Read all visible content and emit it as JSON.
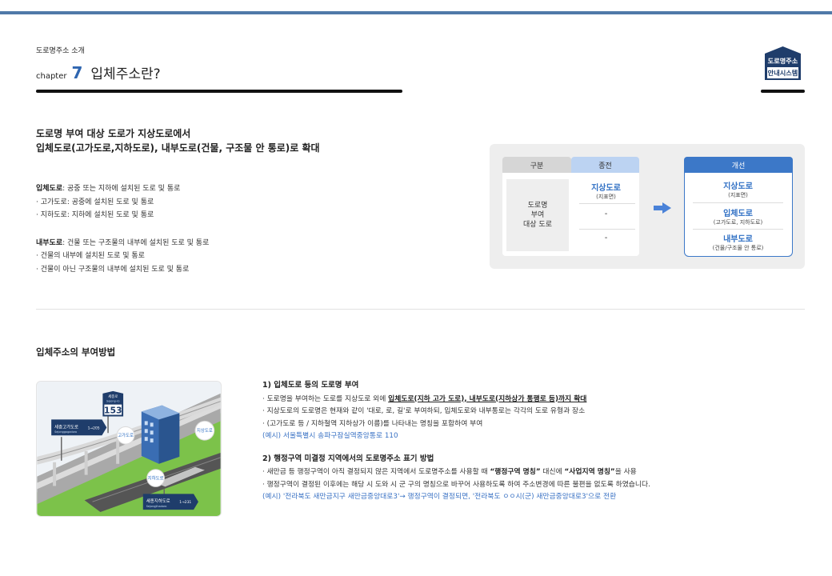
{
  "header": {
    "breadcrumb": "도로명주소 소개",
    "chapter_word": "chapter",
    "chapter_number": "7",
    "title": "입체주소란?",
    "logo_line1": "도로명주소",
    "logo_line2": "안내시스템"
  },
  "intro": {
    "line1": "도로명 부여 대상 도로가 지상도로에서",
    "line2": "입체도로(고가도로,지하도로), 내부도로(건물, 구조물 안 통로)로 확대"
  },
  "definitions": {
    "ipche_term": "입체도로",
    "ipche_desc": ": 공중 또는 지하에 설치된 도로 및 통로",
    "ipche_items": [
      "· 고가도로: 공중에 설치된 도로 및 통로",
      "· 지하도로: 지하에 설치된 도로 및 통로"
    ],
    "naebu_term": "내부도로",
    "naebu_desc": ": 건물 또는 구조물의 내부에 설치된 도로 및 통로",
    "naebu_items": [
      "· 건물의 내부에 설치된 도로 및 통로",
      "· 건물이 아닌 구조물의 내부에 설치된 도로 및 통로"
    ]
  },
  "comparison": {
    "col_gubun": "구분",
    "col_prev": "종전",
    "col_new": "개선",
    "gubun_line1": "도로명",
    "gubun_line2": "부여",
    "gubun_line3": "대상 도로",
    "prev_main": "지상도로",
    "prev_sub": "(지표면)",
    "prev_dash1": "-",
    "prev_dash2": "-",
    "new_items": [
      {
        "main": "지상도로",
        "sub": "(지표면)"
      },
      {
        "main": "입체도로",
        "sub": "(고가도로, 지하도로)"
      },
      {
        "main": "내부도로",
        "sub": "(건물/구조물 안 통로)"
      }
    ]
  },
  "section": {
    "title": "입체주소의 부여방법"
  },
  "illustration": {
    "sign_top_name": "세종로",
    "sign_top_roman": "Sejong-ro",
    "sign_top_number": "153",
    "sign_elevated_name": "세종고가도로",
    "sign_elevated_number": "1→205",
    "sign_elevated_roman": "Sejonggogadoro",
    "sign_underground_name": "세종지하도로",
    "sign_underground_number": "1→231",
    "sign_underground_roman": "Sejongjihadoro",
    "bubble_goga": "고가도로",
    "bubble_jisang": "지상도로",
    "bubble_jiha": "지하도로"
  },
  "methods": {
    "m1_title": "1) 입체도로 등의 도로명 부여",
    "m1_l1_pre": "· 도로명을 부여하는 도로를 지상도로 외에 ",
    "m1_l1_em": "입체도로(지하  고가 도로), 내부도로(지하상가 통행로 등)까지 확대",
    "m1_l2": "· 지상도로의 도로명은 현재와 같이 '대로, 로, 길'로 부여하되, 입체도로와 내부통로는 각각의 도로 유형과 장소",
    "m1_l3": "· (고가도로 등 / 지하철역  지하상가 이름)를 나타내는 명칭을 포함하여 부여",
    "m1_example": "(예시) 서울특별시 송파구잠실역중앙통로 110",
    "m2_title": "2) 행정구역 미결정 지역에서의 도로명주소 표기 방법",
    "m2_l1_pre": "· 새만금 등 행정구역이 아직 결정되지 않은 지역에서 도로명주소를 사용할 때 ",
    "m2_l1_b1": "“행정구역 명칭”",
    "m2_l1_mid": " 대신에 ",
    "m2_l1_b2": "“사업지역 명칭”",
    "m2_l1_post": "을 사용",
    "m2_l2": "· 행정구역이 결정된 이후에는 해당 시  도와 시  군  구의 명칭으로 바꾸어 사용하도록 하여 주소변경에 따른 불편을 없도록 하였습니다.",
    "m2_example": "(예시) '전라북도 새만금지구 새만금중앙대로3'→ 행정구역이 결정되면, '전라북도 ㅇㅇ시(군) 새만금중앙대로3'으로 전환"
  },
  "colors": {
    "accent_blue": "#2f6fc4",
    "header_bar": "#4f79a8",
    "logo_navy": "#1f3d6b"
  }
}
